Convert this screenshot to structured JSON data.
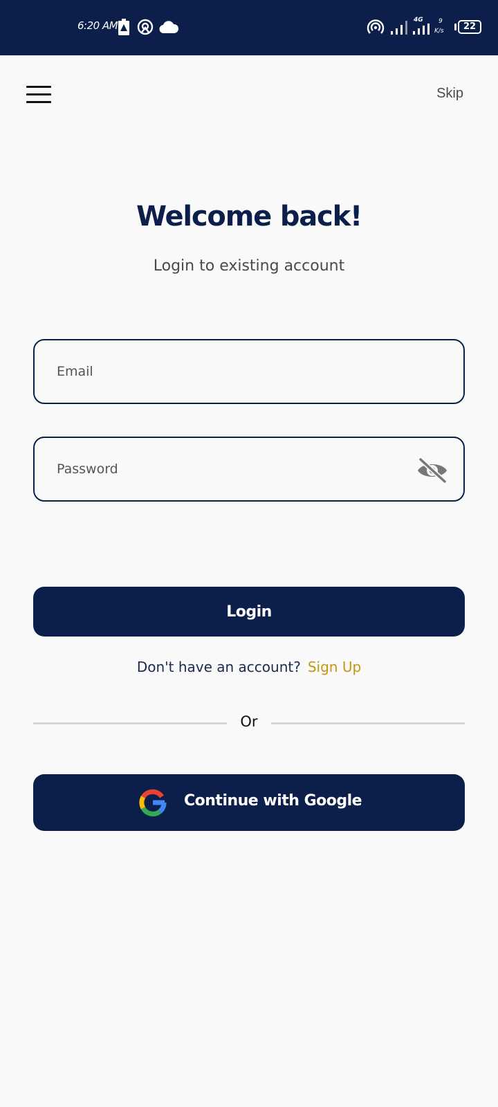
{
  "status_bar": {
    "time": "6:20 AM",
    "network_type": "4G",
    "speed_value": "9",
    "speed_unit": "K/s",
    "battery": "22",
    "background_color": "#0b1f4a",
    "icons": [
      "battery-alert-icon",
      "hotspot-icon",
      "cloud-icon",
      "wifi-hotspot-icon",
      "signal-icon",
      "signal-4g-icon"
    ]
  },
  "header": {
    "menu_icon": "hamburger-menu-icon",
    "skip_label": "Skip"
  },
  "main": {
    "title": "Welcome back!",
    "subtitle": "Login to existing account",
    "email": {
      "placeholder": "Email",
      "value": ""
    },
    "password": {
      "placeholder": "Password",
      "value": "",
      "toggle_icon": "eye-off-icon"
    },
    "login_label": "Login",
    "signup_prompt": "Don't have an account?",
    "signup_link": "Sign Up",
    "divider_text": "Or",
    "google_label": "Continue with Google",
    "google_icon": "google-logo-icon"
  },
  "colors": {
    "primary": "#0b1f4a",
    "accent": "#c5960f",
    "background": "#f9f9f9"
  }
}
